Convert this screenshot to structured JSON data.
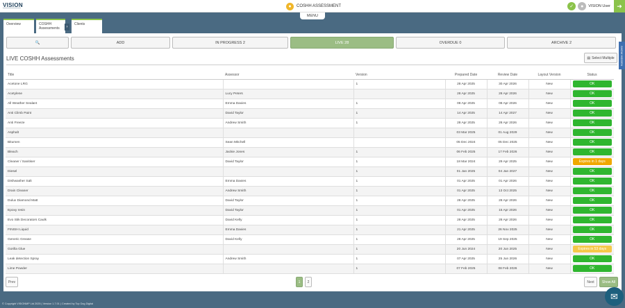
{
  "header": {
    "logo": "VISION",
    "title": "COSHH ASSESSMENT",
    "menu": "MENU",
    "user": "VISION User",
    "status_color": "#8bc34a"
  },
  "tabs": [
    {
      "label": "Overview"
    },
    {
      "label": "COSHH Assessments"
    },
    {
      "label": "Clients"
    }
  ],
  "filters": {
    "search_icon": "search-icon",
    "add": "ADD",
    "in_progress": "IN PROGRESS  2",
    "live": "LIVE  28",
    "overdue": "OVERDUE  0",
    "archive": "ARCHIVE  2"
  },
  "side_tab": "SHOW HIDDEN",
  "section_title": "LIVE COSHH Assessments",
  "select_multiple": "Select Multiple",
  "table": {
    "headers": [
      "Title",
      "Assessor",
      "Version",
      "Prepared Date",
      "Review Date",
      "Layout Version",
      "Status"
    ],
    "rows": [
      {
        "title": "Acetone LRG",
        "assessor": "",
        "version": "1",
        "prepared": "28 Apr 2025",
        "review": "30 Apr 2026",
        "layout": "New",
        "status": "OK",
        "status_type": "ok"
      },
      {
        "title": "Acetylene",
        "assessor": "Lucy Peters",
        "version": "",
        "prepared": "28 Apr 2025",
        "review": "28 Apr 2026",
        "layout": "New",
        "status": "OK",
        "status_type": "ok"
      },
      {
        "title": "All Weather Sealant",
        "assessor": "Emma Davies",
        "version": "1",
        "prepared": "08 Apr 2025",
        "review": "08 Apr 2026",
        "layout": "New",
        "status": "OK",
        "status_type": "ok"
      },
      {
        "title": "Anti Climb Paint",
        "assessor": "David Taylor",
        "version": "1",
        "prepared": "14 Apr 2025",
        "review": "14 Apr 2027",
        "layout": "New",
        "status": "OK",
        "status_type": "ok"
      },
      {
        "title": "Anti Freeze",
        "assessor": "Andrew Smith",
        "version": "1",
        "prepared": "28 Apr 2025",
        "review": "28 Apr 2026",
        "layout": "New",
        "status": "OK",
        "status_type": "ok"
      },
      {
        "title": "Asphalt",
        "assessor": "",
        "version": "",
        "prepared": "03 Mar 2025",
        "review": "01 Aug 2029",
        "layout": "New",
        "status": "OK",
        "status_type": "ok"
      },
      {
        "title": "Bitumen",
        "assessor": "Sean Mitchell",
        "version": "",
        "prepared": "05 Dec 2024",
        "review": "05 Dec 2025",
        "layout": "New",
        "status": "OK",
        "status_type": "ok"
      },
      {
        "title": "Bleach",
        "assessor": "Jackie Jones",
        "version": "1",
        "prepared": "06 Feb 2025",
        "review": "17 Feb 2026",
        "layout": "New",
        "status": "OK",
        "status_type": "ok"
      },
      {
        "title": "Cleaner / Sanitiser",
        "assessor": "David Taylor",
        "version": "1",
        "prepared": "18 Mar 2024",
        "review": "29 Apr 2025",
        "layout": "New",
        "status": "Expires in 1 days",
        "status_type": "warn"
      },
      {
        "title": "Diesel",
        "assessor": "",
        "version": "1",
        "prepared": "01 Jan 2025",
        "review": "04 Jan 2027",
        "layout": "New",
        "status": "OK",
        "status_type": "ok"
      },
      {
        "title": "Dishwasher Salt",
        "assessor": "Emma Davies",
        "version": "1",
        "prepared": "01 Apr 2025",
        "review": "01 Apr 2026",
        "layout": "New",
        "status": "OK",
        "status_type": "ok"
      },
      {
        "title": "Drain Cleaner",
        "assessor": "Andrew Smith",
        "version": "1",
        "prepared": "01 Apr 2025",
        "review": "13 Oct 2025",
        "layout": "New",
        "status": "OK",
        "status_type": "ok"
      },
      {
        "title": "Dulux Diamond Matt",
        "assessor": "David Taylor",
        "version": "1",
        "prepared": "28 Apr 2025",
        "review": "28 Apr 2026",
        "layout": "New",
        "status": "OK",
        "status_type": "ok"
      },
      {
        "title": "Epoxy resin",
        "assessor": "David Taylor",
        "version": "1",
        "prepared": "01 Apr 2025",
        "review": "15 Apr 2026",
        "layout": "New",
        "status": "OK",
        "status_type": "ok"
      },
      {
        "title": "Evo Stik Decorators Caulk",
        "assessor": "David Kelly",
        "version": "1",
        "prepared": "28 Apr 2025",
        "review": "28 Apr 2026",
        "layout": "New",
        "status": "OK",
        "status_type": "ok"
      },
      {
        "title": "FINISH Liquid",
        "assessor": "Emma Davies",
        "version": "1",
        "prepared": "21 Apr 2025",
        "review": "26 Nov 2025",
        "layout": "New",
        "status": "OK",
        "status_type": "ok"
      },
      {
        "title": "Generic Grease",
        "assessor": "David Kelly",
        "version": "1",
        "prepared": "28 Apr 2025",
        "review": "19 Sep 2025",
        "layout": "New",
        "status": "OK",
        "status_type": "ok"
      },
      {
        "title": "Gorilla Glue",
        "assessor": "",
        "version": "1",
        "prepared": "20 Jun 2024",
        "review": "20 Jun 2025",
        "layout": "New",
        "status": "Expires in 53 days",
        "status_type": "warn2"
      },
      {
        "title": "Leak detection Spray",
        "assessor": "Andrew Smith",
        "version": "1",
        "prepared": "07 Apr 2025",
        "review": "25 Jun 2026",
        "layout": "New",
        "status": "OK",
        "status_type": "ok"
      },
      {
        "title": "Lime Powder",
        "assessor": "",
        "version": "1",
        "prepared": "07 Feb 2025",
        "review": "08 Feb 2026",
        "layout": "New",
        "status": "OK",
        "status_type": "ok"
      }
    ]
  },
  "status_colors": {
    "ok": "#2fb62f",
    "warn": "#f0a800",
    "warn2": "#f4c84a"
  },
  "pager": {
    "prev": "Prev",
    "pages": [
      "1",
      "2"
    ],
    "current": "1",
    "next": "Next",
    "show_all": "Show All"
  },
  "footer": "© Copyright VISIONMP Ltd 2025 | Version 1.7.01 | Created by Top Dog Digital",
  "mail_icon": "mail-icon"
}
